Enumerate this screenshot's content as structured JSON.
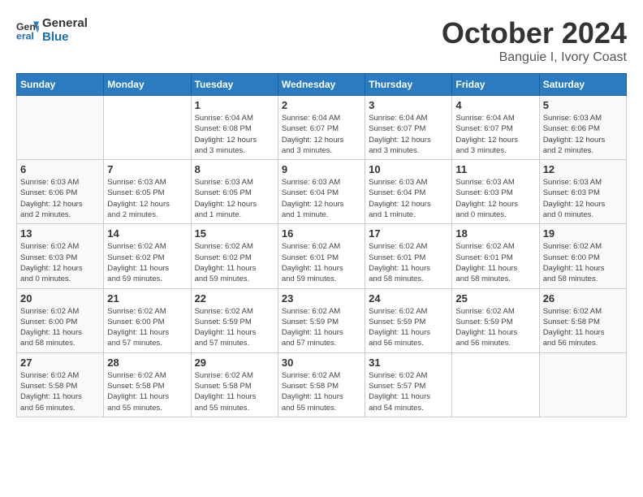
{
  "header": {
    "logo_line1": "General",
    "logo_line2": "Blue",
    "month": "October 2024",
    "location": "Banguie I, Ivory Coast"
  },
  "weekdays": [
    "Sunday",
    "Monday",
    "Tuesday",
    "Wednesday",
    "Thursday",
    "Friday",
    "Saturday"
  ],
  "weeks": [
    [
      {
        "day": "",
        "info": ""
      },
      {
        "day": "",
        "info": ""
      },
      {
        "day": "1",
        "info": "Sunrise: 6:04 AM\nSunset: 6:08 PM\nDaylight: 12 hours\nand 3 minutes."
      },
      {
        "day": "2",
        "info": "Sunrise: 6:04 AM\nSunset: 6:07 PM\nDaylight: 12 hours\nand 3 minutes."
      },
      {
        "day": "3",
        "info": "Sunrise: 6:04 AM\nSunset: 6:07 PM\nDaylight: 12 hours\nand 3 minutes."
      },
      {
        "day": "4",
        "info": "Sunrise: 6:04 AM\nSunset: 6:07 PM\nDaylight: 12 hours\nand 3 minutes."
      },
      {
        "day": "5",
        "info": "Sunrise: 6:03 AM\nSunset: 6:06 PM\nDaylight: 12 hours\nand 2 minutes."
      }
    ],
    [
      {
        "day": "6",
        "info": "Sunrise: 6:03 AM\nSunset: 6:06 PM\nDaylight: 12 hours\nand 2 minutes."
      },
      {
        "day": "7",
        "info": "Sunrise: 6:03 AM\nSunset: 6:05 PM\nDaylight: 12 hours\nand 2 minutes."
      },
      {
        "day": "8",
        "info": "Sunrise: 6:03 AM\nSunset: 6:05 PM\nDaylight: 12 hours\nand 1 minute."
      },
      {
        "day": "9",
        "info": "Sunrise: 6:03 AM\nSunset: 6:04 PM\nDaylight: 12 hours\nand 1 minute."
      },
      {
        "day": "10",
        "info": "Sunrise: 6:03 AM\nSunset: 6:04 PM\nDaylight: 12 hours\nand 1 minute."
      },
      {
        "day": "11",
        "info": "Sunrise: 6:03 AM\nSunset: 6:03 PM\nDaylight: 12 hours\nand 0 minutes."
      },
      {
        "day": "12",
        "info": "Sunrise: 6:03 AM\nSunset: 6:03 PM\nDaylight: 12 hours\nand 0 minutes."
      }
    ],
    [
      {
        "day": "13",
        "info": "Sunrise: 6:02 AM\nSunset: 6:03 PM\nDaylight: 12 hours\nand 0 minutes."
      },
      {
        "day": "14",
        "info": "Sunrise: 6:02 AM\nSunset: 6:02 PM\nDaylight: 11 hours\nand 59 minutes."
      },
      {
        "day": "15",
        "info": "Sunrise: 6:02 AM\nSunset: 6:02 PM\nDaylight: 11 hours\nand 59 minutes."
      },
      {
        "day": "16",
        "info": "Sunrise: 6:02 AM\nSunset: 6:01 PM\nDaylight: 11 hours\nand 59 minutes."
      },
      {
        "day": "17",
        "info": "Sunrise: 6:02 AM\nSunset: 6:01 PM\nDaylight: 11 hours\nand 58 minutes."
      },
      {
        "day": "18",
        "info": "Sunrise: 6:02 AM\nSunset: 6:01 PM\nDaylight: 11 hours\nand 58 minutes."
      },
      {
        "day": "19",
        "info": "Sunrise: 6:02 AM\nSunset: 6:00 PM\nDaylight: 11 hours\nand 58 minutes."
      }
    ],
    [
      {
        "day": "20",
        "info": "Sunrise: 6:02 AM\nSunset: 6:00 PM\nDaylight: 11 hours\nand 58 minutes."
      },
      {
        "day": "21",
        "info": "Sunrise: 6:02 AM\nSunset: 6:00 PM\nDaylight: 11 hours\nand 57 minutes."
      },
      {
        "day": "22",
        "info": "Sunrise: 6:02 AM\nSunset: 5:59 PM\nDaylight: 11 hours\nand 57 minutes."
      },
      {
        "day": "23",
        "info": "Sunrise: 6:02 AM\nSunset: 5:59 PM\nDaylight: 11 hours\nand 57 minutes."
      },
      {
        "day": "24",
        "info": "Sunrise: 6:02 AM\nSunset: 5:59 PM\nDaylight: 11 hours\nand 56 minutes."
      },
      {
        "day": "25",
        "info": "Sunrise: 6:02 AM\nSunset: 5:59 PM\nDaylight: 11 hours\nand 56 minutes."
      },
      {
        "day": "26",
        "info": "Sunrise: 6:02 AM\nSunset: 5:58 PM\nDaylight: 11 hours\nand 56 minutes."
      }
    ],
    [
      {
        "day": "27",
        "info": "Sunrise: 6:02 AM\nSunset: 5:58 PM\nDaylight: 11 hours\nand 56 minutes."
      },
      {
        "day": "28",
        "info": "Sunrise: 6:02 AM\nSunset: 5:58 PM\nDaylight: 11 hours\nand 55 minutes."
      },
      {
        "day": "29",
        "info": "Sunrise: 6:02 AM\nSunset: 5:58 PM\nDaylight: 11 hours\nand 55 minutes."
      },
      {
        "day": "30",
        "info": "Sunrise: 6:02 AM\nSunset: 5:58 PM\nDaylight: 11 hours\nand 55 minutes."
      },
      {
        "day": "31",
        "info": "Sunrise: 6:02 AM\nSunset: 5:57 PM\nDaylight: 11 hours\nand 54 minutes."
      },
      {
        "day": "",
        "info": ""
      },
      {
        "day": "",
        "info": ""
      }
    ]
  ]
}
